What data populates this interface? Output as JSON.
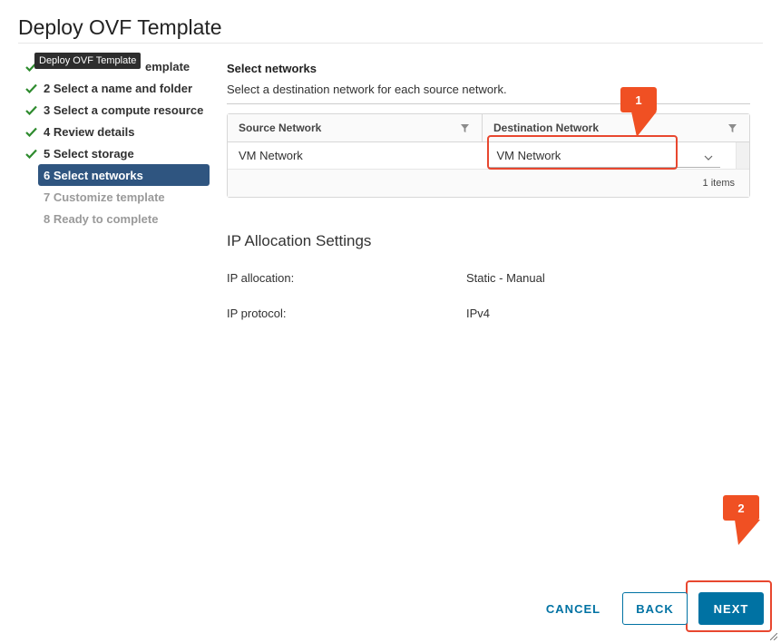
{
  "dialog": {
    "title": "Deploy OVF Template",
    "tooltip": "Deploy OVF Template"
  },
  "steps": [
    {
      "number": "1",
      "label": "Select an OVF template",
      "state": "done",
      "visible_suffix": "emplate"
    },
    {
      "number": "2",
      "label": "2 Select a name and folder",
      "state": "done"
    },
    {
      "number": "3",
      "label": "3 Select a compute resource",
      "state": "done"
    },
    {
      "number": "4",
      "label": "4 Review details",
      "state": "done"
    },
    {
      "number": "5",
      "label": "5 Select storage",
      "state": "done"
    },
    {
      "number": "6",
      "label": "6 Select networks",
      "state": "active"
    },
    {
      "number": "7",
      "label": "7 Customize template",
      "state": "todo"
    },
    {
      "number": "8",
      "label": "8 Ready to complete",
      "state": "todo"
    }
  ],
  "main": {
    "section_title": "Select networks",
    "section_desc": "Select a destination network for each source network."
  },
  "grid": {
    "columns": [
      "Source Network",
      "Destination Network"
    ],
    "rows": [
      {
        "source": "VM Network",
        "destination": "VM Network"
      }
    ],
    "footer": "1 items"
  },
  "ip": {
    "title": "IP Allocation Settings",
    "allocation_label": "IP allocation:",
    "allocation_value": "Static - Manual",
    "protocol_label": "IP protocol:",
    "protocol_value": "IPv4"
  },
  "callouts": {
    "first": "1",
    "second": "2",
    "color": "#f05023"
  },
  "buttons": {
    "cancel": "CANCEL",
    "back": "BACK",
    "next": "NEXT"
  },
  "colors": {
    "primary": "#0072a3",
    "active_step": "#2f5580",
    "check": "#2e8b2e",
    "highlight": "#e8472f"
  }
}
